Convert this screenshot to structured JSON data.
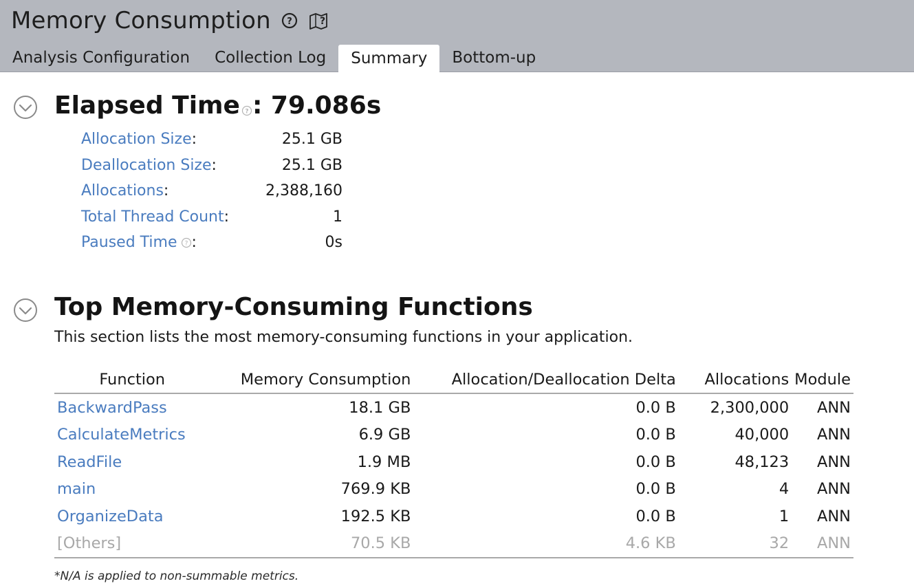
{
  "header": {
    "title": "Memory Consumption",
    "tabs": [
      {
        "label": "Analysis Configuration",
        "active": false
      },
      {
        "label": "Collection Log",
        "active": false
      },
      {
        "label": "Summary",
        "active": true
      },
      {
        "label": "Bottom-up",
        "active": false
      }
    ]
  },
  "elapsed": {
    "label": "Elapsed Time",
    "value": ": 79.086s",
    "metrics": [
      {
        "label": "Allocation Size",
        "value": "25.1 GB"
      },
      {
        "label": "Deallocation Size",
        "value": "25.1 GB"
      },
      {
        "label": "Allocations",
        "value": "2,388,160"
      },
      {
        "label": "Total Thread Count",
        "value": "1"
      },
      {
        "label": "Paused Time",
        "value": "0s",
        "help": true
      }
    ]
  },
  "top_functions": {
    "title": "Top Memory-Consuming Functions",
    "description": "This section lists the most memory-consuming functions in your application.",
    "columns": [
      "Function",
      "Memory Consumption",
      "Allocation/Deallocation Delta",
      "Allocations",
      "Module"
    ],
    "rows": [
      {
        "function": "BackwardPass",
        "memory": "18.1 GB",
        "delta": "0.0 B",
        "allocations": "2,300,000",
        "module": "ANN"
      },
      {
        "function": "CalculateMetrics",
        "memory": "6.9 GB",
        "delta": "0.0 B",
        "allocations": "40,000",
        "module": "ANN"
      },
      {
        "function": "ReadFile",
        "memory": "1.9 MB",
        "delta": "0.0 B",
        "allocations": "48,123",
        "module": "ANN"
      },
      {
        "function": "main",
        "memory": "769.9 KB",
        "delta": "0.0 B",
        "allocations": "4",
        "module": "ANN"
      },
      {
        "function": "OrganizeData",
        "memory": "192.5 KB",
        "delta": "0.0 B",
        "allocations": "1",
        "module": "ANN"
      }
    ],
    "others": {
      "function": "[Others]",
      "memory": "70.5 KB",
      "delta": "4.6 KB",
      "allocations": "32",
      "module": "ANN"
    }
  },
  "footnote": "*N/A is applied to non-summable metrics.",
  "colors": {
    "link": "#4a7cbf",
    "header_bg": "#b4b7be",
    "muted": "#a8a8a8"
  }
}
